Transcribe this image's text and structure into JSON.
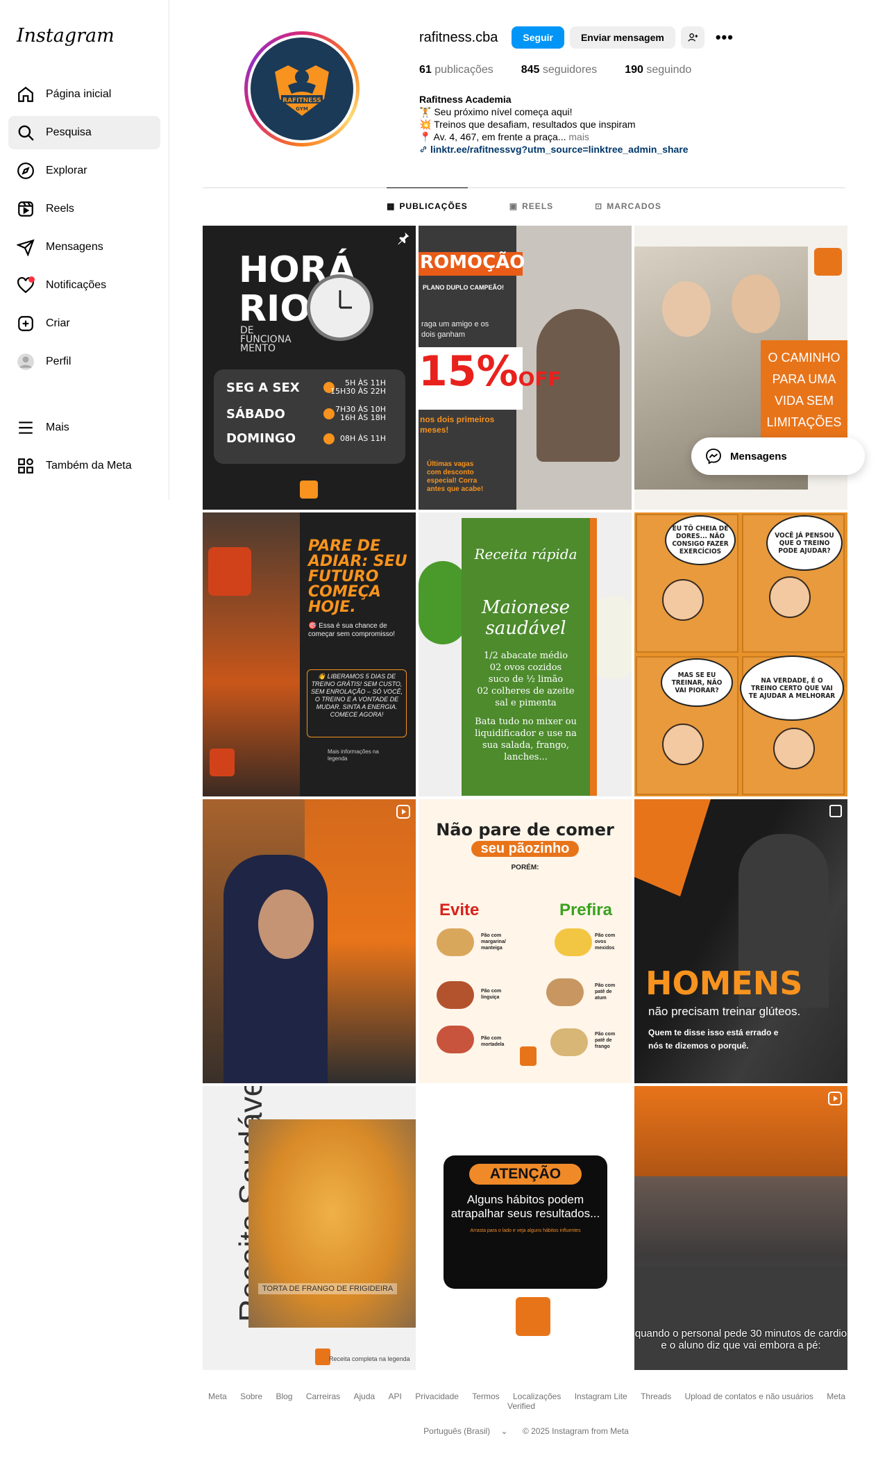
{
  "app": {
    "logo": "Instagram"
  },
  "sidebar": {
    "items": [
      {
        "label": "Página inicial",
        "icon": "home-icon"
      },
      {
        "label": "Pesquisa",
        "icon": "search-icon",
        "active": true
      },
      {
        "label": "Explorar",
        "icon": "compass-icon"
      },
      {
        "label": "Reels",
        "icon": "reels-icon"
      },
      {
        "label": "Mensagens",
        "icon": "send-icon"
      },
      {
        "label": "Notificações",
        "icon": "heart-icon"
      },
      {
        "label": "Criar",
        "icon": "plus-square-icon"
      },
      {
        "label": "Perfil",
        "icon": "profile-avatar-icon"
      }
    ],
    "bottom": [
      {
        "label": "Mais",
        "icon": "menu-icon"
      },
      {
        "label": "Também da Meta",
        "icon": "meta-grid-icon"
      }
    ]
  },
  "profile": {
    "username": "rafitness.cba",
    "follow_label": "Seguir",
    "message_label": "Enviar mensagem",
    "more_label": "•••",
    "stats": {
      "posts_count": "61",
      "posts_label": "publicações",
      "followers_count": "845",
      "followers_label": "seguidores",
      "following_count": "190",
      "following_label": "seguindo"
    },
    "bio": {
      "name": "Rafitness Academia",
      "line1": "🏋️ Seu próximo nível começa aqui!",
      "line2": "💥 Treinos que desafiam, resultados que inspiram",
      "line3": "📍 Av. 4, 467, em frente a praça...",
      "more": "mais",
      "link": "linktr.ee/rafitnessvg?utm_source=linktree_admin_share"
    },
    "avatar_text": "RAFITNESS GYM"
  },
  "tabs": [
    {
      "label": "PUBLICAÇÕES",
      "icon": "grid-icon",
      "active": true
    },
    {
      "label": "REELS",
      "icon": "reels-icon"
    },
    {
      "label": "MARCADOS",
      "icon": "tagged-icon"
    }
  ],
  "posts": {
    "p1": {
      "title": "HORÁ RIO",
      "sub": "DE FUNCIONA MENTO",
      "rows": [
        {
          "day": "SEG A SEX",
          "hours": "5H ÀS 11H\n15H30 ÀS 22H"
        },
        {
          "day": "SÁBADO",
          "hours": "7H30 ÀS 10H\n16H ÀS 18H"
        },
        {
          "day": "DOMINGO",
          "hours": "08H ÀS 11H"
        }
      ]
    },
    "p2": {
      "banner": "ROMOÇÃO",
      "t1": "PLANO DUPLO CAMPEÃO!",
      "t2": "raga um amigo e os dois ganham",
      "pct": "15%",
      "off": "OFF",
      "t3": "nos dois primeiros meses!",
      "t4": "Últimas vagas com desconto especial! Corra antes que acabe!"
    },
    "p3": {
      "text": "O CAMINHO PARA UMA VIDA SEM LIMITAÇÕES"
    },
    "p4": {
      "head": "PARE DE ADIAR: SEU FUTURO COMEÇA HOJE.",
      "p": "🎯 Essa é sua chance de começar sem compromisso!",
      "box": "👋 LIBERAMOS 5 DIAS DE TREINO GRÁTIS! SEM CUSTO, SEM ENROLAÇÃO – SÓ VOCÊ, O TREINO E A VONTADE DE MUDAR. SINTA A ENERGIA. COMECE AGORA!",
      "foot": "Mais informações na legenda"
    },
    "p5": {
      "t1": "Receita rápida",
      "t2": "Maionese saudável",
      "t3": "1/2 abacate médio\n02 ovos cozidos\nsuco de ½ limão\n02 colheres de azeite\nsal e pimenta",
      "t4": "Bata tudo no mixer ou liquidificador e use na sua salada, frango, lanches..."
    },
    "p6": {
      "b1": "EU TÔ CHEIA DE DORES... NÃO CONSIGO FAZER EXERCÍCIOS",
      "b2": "VOCÊ JÁ PENSOU QUE O TREINO PODE AJUDAR?",
      "b3": "MAS SE EU TREINAR, NÃO VAI PIORAR?",
      "b4": "NA VERDADE, É O TREINO CERTO QUE VAI TE AJUDAR A MELHORAR"
    },
    "p8": {
      "h1": "Não pare de comer",
      "h2": "seu pãozinho",
      "por": "PORÉM:",
      "evite": "Evite",
      "prefira": "Prefira",
      "e1": "Pão com margarina/ manteiga",
      "e2": "Pão com linguiça",
      "e3": "Pão com mortadela",
      "f1": "Pão com ovos mexidos",
      "f2": "Pão com patê de atum",
      "f3": "Pão com patê de frango"
    },
    "p9": {
      "head": "HOMENS",
      "t1": "não precisam treinar glúteos.",
      "t2": "Quem te disse isso está errado e nós te dizemos o porquê."
    },
    "p10": {
      "vert": "Receita Saudável",
      "cap": "TORTA DE FRANGO DE FRIGIDEIRA",
      "foot": "Receita completa na legenda"
    },
    "p11": {
      "pill": "ATENÇÃO",
      "t1": "Alguns hábitos podem atrapalhar seus resultados...",
      "t2": "Arrasta para o lado e veja alguns hábitos influentes"
    },
    "p12": {
      "cap": "quando o personal pede 30 minutos de cardio e o aluno diz que vai embora a pé:"
    }
  },
  "floating": {
    "messages_label": "Mensagens"
  },
  "footer": {
    "links": [
      "Meta",
      "Sobre",
      "Blog",
      "Carreiras",
      "Ajuda",
      "API",
      "Privacidade",
      "Termos",
      "Localizações",
      "Instagram Lite",
      "Threads",
      "Upload de contatos e não usuários",
      "Meta Verified"
    ],
    "language": "Português (Brasil)",
    "copyright": "© 2025 Instagram from Meta"
  },
  "colors": {
    "accent": "#0095f6",
    "brand_orange": "#e8741a",
    "notification": "#ff3040"
  }
}
